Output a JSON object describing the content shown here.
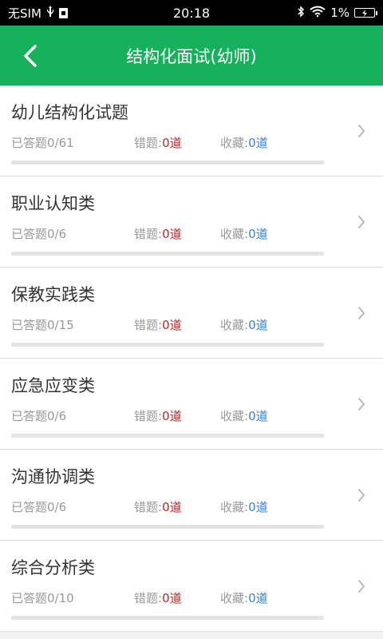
{
  "status_bar": {
    "carrier": "无SIM",
    "time": "20:18",
    "battery": "1%"
  },
  "header": {
    "title": "结构化面试(幼师)"
  },
  "items": [
    {
      "title": "幼儿结构化试题",
      "answered_label": "已答题",
      "answered": "0/61",
      "progress": 0,
      "wrong_label": "错题:",
      "wrong": "0道",
      "fav_label": "收藏:",
      "fav": "0道"
    },
    {
      "title": "职业认知类",
      "answered_label": "已答题",
      "answered": "0/6",
      "progress": 0,
      "wrong_label": "错题:",
      "wrong": "0道",
      "fav_label": "收藏:",
      "fav": "0道"
    },
    {
      "title": "保教实践类",
      "answered_label": "已答题",
      "answered": "0/15",
      "progress": 0,
      "wrong_label": "错题:",
      "wrong": "0道",
      "fav_label": "收藏:",
      "fav": "0道"
    },
    {
      "title": "应急应变类",
      "answered_label": "已答题",
      "answered": "0/6",
      "progress": 0,
      "wrong_label": "错题:",
      "wrong": "0道",
      "fav_label": "收藏:",
      "fav": "0道"
    },
    {
      "title": "沟通协调类",
      "answered_label": "已答题",
      "answered": "0/6",
      "progress": 0,
      "wrong_label": "错题:",
      "wrong": "0道",
      "fav_label": "收藏:",
      "fav": "0道"
    },
    {
      "title": "综合分析类",
      "answered_label": "已答题",
      "answered": "0/10",
      "progress": 0,
      "wrong_label": "错题:",
      "wrong": "0道",
      "fav_label": "收藏:",
      "fav": "0道"
    }
  ]
}
